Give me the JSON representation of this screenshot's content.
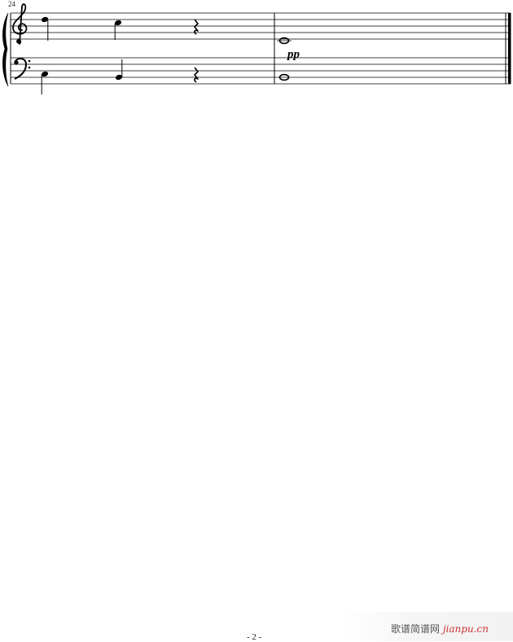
{
  "score": {
    "measure_number": "24",
    "dynamic": "pp",
    "page_number": "- 2 -"
  },
  "watermark": {
    "site_cn": "歌谱简谱网",
    "site_url": "jianpu.cn"
  }
}
